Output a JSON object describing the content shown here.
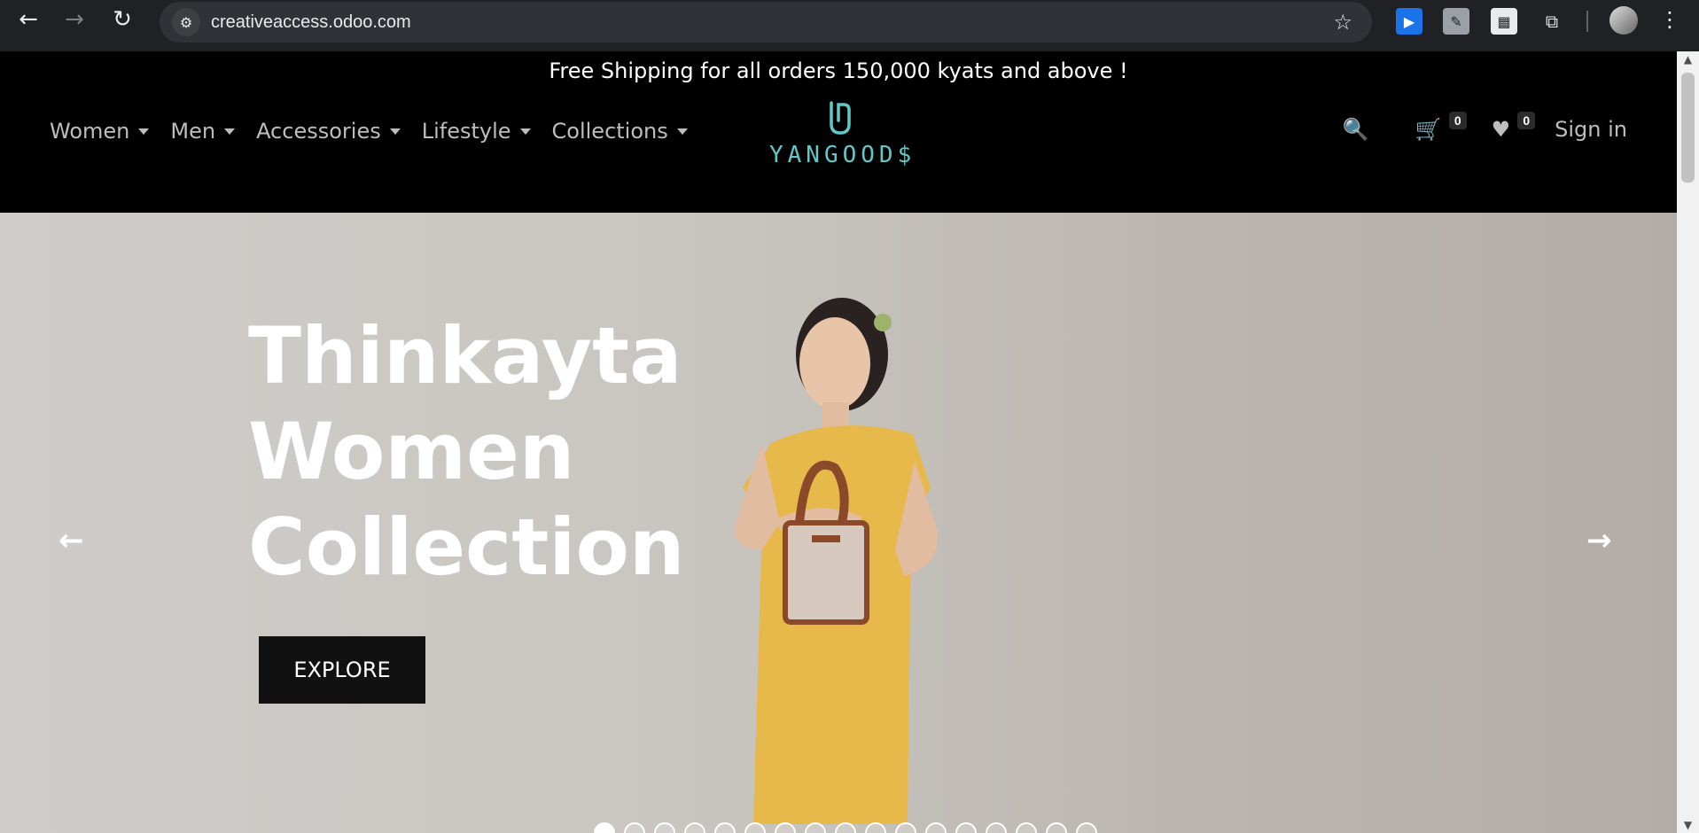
{
  "browser": {
    "url": "creativeaccess.odoo.com",
    "back_icon": "←",
    "forward_icon": "→",
    "reload_icon": "↻",
    "site_info_icon": "⚙",
    "bookmark_icon": "☆",
    "extensions_icon": "⧉",
    "menu_icon": "⋮"
  },
  "announcement": "Free Shipping for all orders 150,000 kyats and above !",
  "nav": {
    "items": [
      {
        "label": "Women"
      },
      {
        "label": "Men"
      },
      {
        "label": "Accessories"
      },
      {
        "label": "Lifestyle"
      },
      {
        "label": "Collections"
      }
    ]
  },
  "logo": {
    "text": "YANGOOD$",
    "color": "#63c7c7"
  },
  "tools": {
    "search_icon": "🔍",
    "cart_icon": "🛒",
    "cart_count": "0",
    "wishlist_icon": "♥",
    "wishlist_count": "0",
    "signin_label": "Sign in"
  },
  "hero": {
    "title_line1": "Thinkayta",
    "title_line2": "Women",
    "title_line3": "Collection",
    "button_label": "EXPLORE",
    "prev_icon": "←",
    "next_icon": "→",
    "slides_count": 17,
    "active_slide": 1
  },
  "scrollbar": {
    "up": "▲",
    "down": "▼"
  }
}
